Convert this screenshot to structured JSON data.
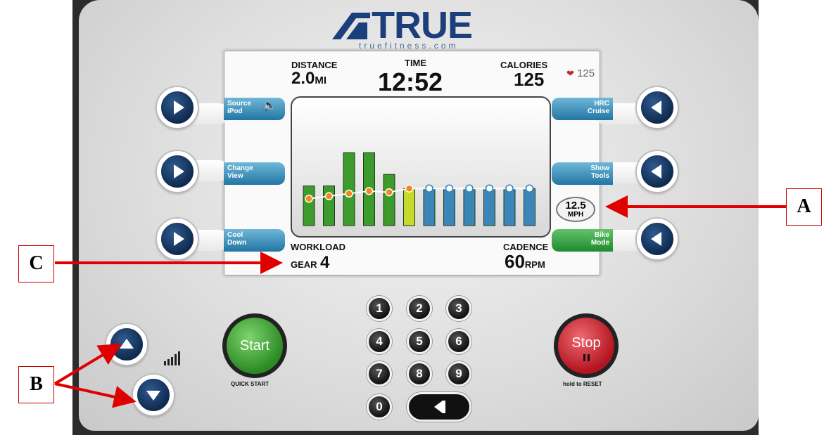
{
  "brand": {
    "name": "TRUE",
    "site": "truefitness.com"
  },
  "display": {
    "distance_label": "DISTANCE",
    "distance_value": "2.0",
    "distance_unit": "MI",
    "time_label": "TIME",
    "time_value": "12:52",
    "calories_label": "CALORIES",
    "calories_value": "125",
    "heart_rate": "125",
    "workload_label": "WORKLOAD",
    "gear_prefix": "GEAR",
    "gear_value": "4",
    "cadence_label": "CADENCE",
    "cadence_value": "60",
    "cadence_unit": "RPM",
    "speed_value": "12.5",
    "speed_unit": "MPH"
  },
  "left_keys": [
    {
      "line1": "Source",
      "line2": "iPod"
    },
    {
      "line1": "Change",
      "line2": "View"
    },
    {
      "line1": "Cool",
      "line2": "Down"
    }
  ],
  "right_keys": [
    {
      "line1": "HRC",
      "line2": "Cruise"
    },
    {
      "line1": "Show",
      "line2": "Tools"
    },
    {
      "line1": "Bike",
      "line2": "Mode"
    }
  ],
  "keypad": [
    "1",
    "2",
    "3",
    "4",
    "5",
    "6",
    "7",
    "8",
    "9",
    "0"
  ],
  "start": {
    "label": "Start",
    "caption": "QUICK START"
  },
  "stop": {
    "label": "Stop",
    "caption": "hold to RESET"
  },
  "callouts": {
    "a": "A",
    "b": "B",
    "c": "C"
  },
  "profile": {
    "bars": [
      {
        "level": 0.31,
        "state": "done"
      },
      {
        "level": 0.31,
        "state": "done"
      },
      {
        "level": 0.57,
        "state": "done"
      },
      {
        "level": 0.57,
        "state": "done"
      },
      {
        "level": 0.4,
        "state": "done"
      },
      {
        "level": 0.29,
        "state": "current"
      },
      {
        "level": 0.29,
        "state": "upcoming"
      },
      {
        "level": 0.29,
        "state": "upcoming"
      },
      {
        "level": 0.29,
        "state": "upcoming"
      },
      {
        "level": 0.29,
        "state": "upcoming"
      },
      {
        "level": 0.29,
        "state": "upcoming"
      },
      {
        "level": 0.29,
        "state": "upcoming"
      }
    ],
    "line_levels": [
      0.21,
      0.23,
      0.25,
      0.27,
      0.26,
      0.29,
      0.29,
      0.29,
      0.29,
      0.29,
      0.29,
      0.29
    ],
    "colors": {
      "done": "#3d9a2c",
      "current": "#c7d92c",
      "upcoming": "#3b86b7",
      "dot_done": "#f08a1a",
      "dot_upcoming": "#2d7fbf"
    }
  }
}
